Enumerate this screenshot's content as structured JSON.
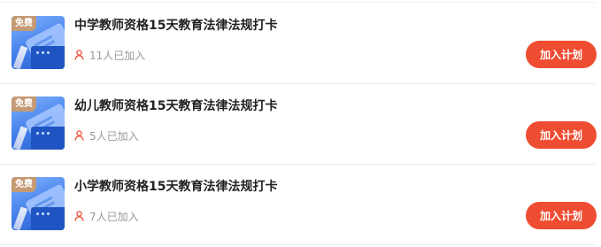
{
  "items": [
    {
      "badge": "免费",
      "title": "中学教师资格15天教育法律法规打卡",
      "joined": "11人已加入",
      "button_label": "加入计划"
    },
    {
      "badge": "免费",
      "title": "幼儿教师资格15天教育法律法规打卡",
      "joined": "5人已加入",
      "button_label": "加入计划"
    },
    {
      "badge": "免费",
      "title": "小学教师资格15天教育法律法规打卡",
      "joined": "7人已加入",
      "button_label": "加入计划"
    }
  ],
  "colors": {
    "accent": "#ee4d32",
    "badge": "#c49a74",
    "title": "#222222",
    "meta": "#999999",
    "user_icon": "#ee4d32"
  },
  "icons": {
    "user": "user-icon",
    "thumbnail": "course-thumbnail"
  }
}
